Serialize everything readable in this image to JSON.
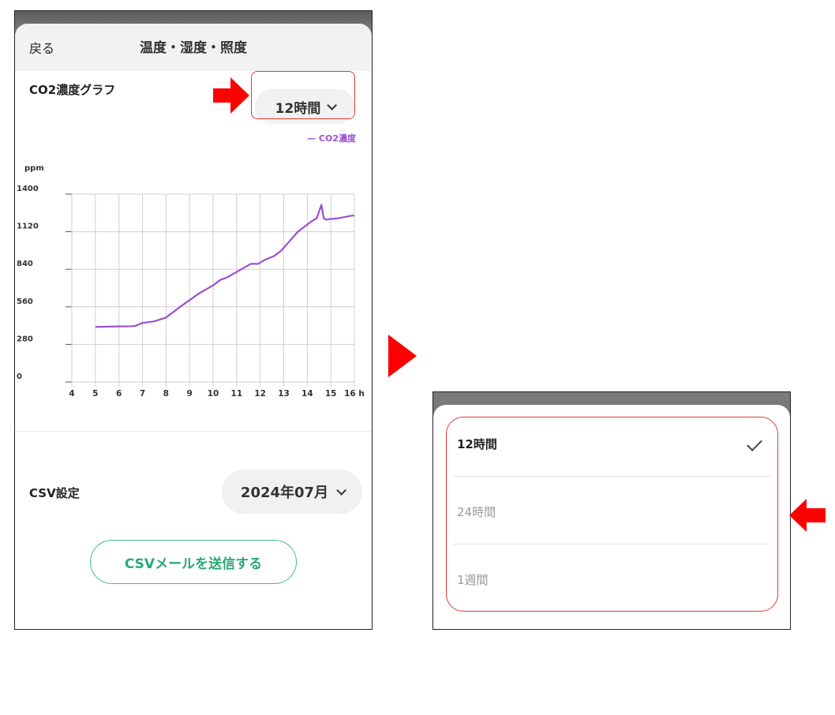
{
  "screen1": {
    "header": {
      "back_label": "戻る",
      "title": "温度・湿度・照度"
    },
    "graph_label": "CO2濃度グラフ",
    "range_button": {
      "label": "12時間"
    },
    "legend": "— CO2濃度",
    "csv": {
      "label": "CSV設定",
      "month": "2024年07月",
      "send_button": "CSVメールを送信する"
    }
  },
  "screen2": {
    "options": [
      {
        "label": "12時間",
        "selected": true
      },
      {
        "label": "24時間",
        "selected": false
      },
      {
        "label": "1週間",
        "selected": false
      }
    ]
  },
  "colors": {
    "accent_red": "#ff0000",
    "series": "#9c4fd1",
    "send_green": "#2aa876"
  },
  "chart_data": {
    "type": "line",
    "ylabel": "ppm",
    "xlabel": "h",
    "x_ticks": [
      4,
      5,
      6,
      7,
      8,
      9,
      10,
      11,
      12,
      13,
      14,
      15,
      16
    ],
    "x_tick_labels": [
      "4",
      "5",
      "6",
      "7",
      "8",
      "9",
      "10",
      "11",
      "12",
      "13",
      "14",
      "15",
      "16 h"
    ],
    "y_ticks": [
      0,
      280,
      560,
      840,
      1120,
      1400
    ],
    "xlim": [
      4,
      16
    ],
    "ylim": [
      0,
      1400
    ],
    "grid": true,
    "legend_position": "top-right",
    "series": [
      {
        "name": "CO2濃度",
        "x": [
          5,
          5.5,
          6,
          6.5,
          6.7,
          7,
          7.5,
          8,
          8.3,
          8.6,
          9,
          9.4,
          9.7,
          10,
          10.3,
          10.6,
          10.9,
          11.2,
          11.6,
          11.9,
          12.2,
          12.6,
          12.9,
          13.2,
          13.6,
          13.9,
          14.2,
          14.4,
          14.6,
          14.7,
          14.8,
          15,
          15.3,
          15.6,
          15.9,
          16
        ],
        "y": [
          410,
          412,
          414,
          415,
          418,
          440,
          452,
          480,
          520,
          560,
          610,
          660,
          690,
          720,
          760,
          780,
          810,
          840,
          880,
          880,
          910,
          940,
          980,
          1040,
          1120,
          1160,
          1200,
          1220,
          1320,
          1220,
          1210,
          1215,
          1220,
          1230,
          1240,
          1240
        ]
      }
    ]
  }
}
